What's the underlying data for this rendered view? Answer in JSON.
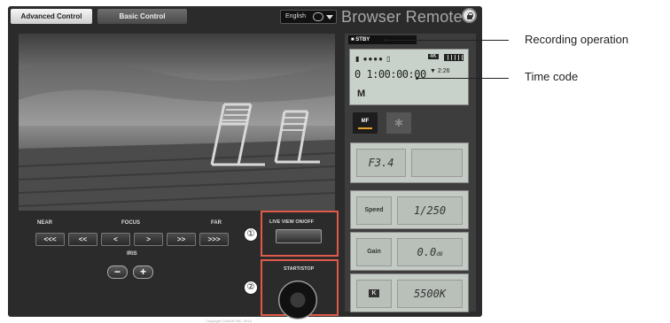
{
  "tabs": {
    "advanced": "Advanced Control",
    "basic": "Basic Control"
  },
  "language": {
    "selected": "English",
    "chat_icon": "speech-bubble-icon",
    "dropdown_icon": "chevron-down-icon"
  },
  "brand": {
    "title": "Browser Remote",
    "lock_icon": "lock-icon"
  },
  "focus": {
    "near_label": "NEAR",
    "focus_label": "FOCUS",
    "far_label": "FAR",
    "buttons": [
      "<<<",
      "<<",
      "<",
      ">",
      ">>",
      ">>>"
    ]
  },
  "iris": {
    "label": "IRIS",
    "minus": "−",
    "plus": "+"
  },
  "live_view": {
    "marker": "①",
    "label": "LIVE VIEW ON/OFF"
  },
  "start_stop": {
    "marker": "②",
    "label": "START/STOP"
  },
  "status": {
    "recording": "STBY"
  },
  "lcd": {
    "rec_indicator": "●●●●",
    "format": "4K",
    "timecode": "0 1:00:00:00",
    "mode": "M",
    "sub": "▼ 2:26"
  },
  "focus_mode": {
    "mf": "MF",
    "star_icon": "asterisk-icon"
  },
  "settings": {
    "aperture": "F3.4",
    "speed_label": "Speed",
    "speed_value": "1/250",
    "gain_label": "Gain",
    "gain_value": "0.0",
    "gain_unit": "dB",
    "wb_icon": "K",
    "wb_value": "5500K"
  },
  "callouts": {
    "recording_operation": "Recording operation",
    "time_code": "Time code"
  },
  "footer": "Copyright CANON INC. 2014"
}
